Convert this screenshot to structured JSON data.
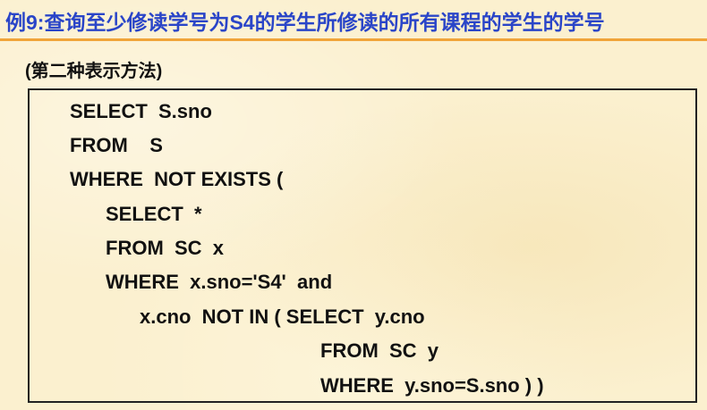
{
  "slide": {
    "title": "例9:查询至少修读学号为S4的学生所修读的所有课程的学生的学号",
    "subtitle": "(第二种表示方法)",
    "code_lines": [
      "SELECT  S.sno",
      "FROM    S",
      "WHERE  NOT EXISTS (",
      "SELECT  *",
      "FROM  SC  x",
      "WHERE  x.sno='S4'  and",
      "x.cno  NOT IN ( SELECT  y.cno",
      "FROM  SC  y",
      "WHERE  y.sno=S.sno ) )"
    ]
  },
  "colors": {
    "title": "#2a45c8",
    "rule": "#f0a43a",
    "background": "#fbf0cf"
  }
}
